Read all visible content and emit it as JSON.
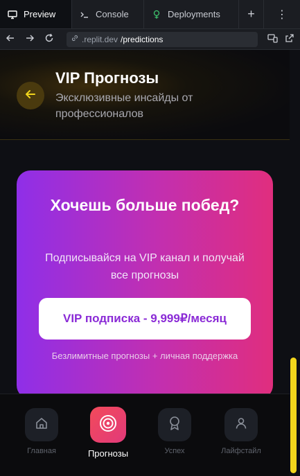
{
  "replit": {
    "tabs": [
      {
        "label": "Preview",
        "icon": "monitor-icon",
        "active": true
      },
      {
        "label": "Console",
        "icon": "terminal-icon"
      },
      {
        "label": "Deployments",
        "icon": "deploy-icon"
      }
    ],
    "add_tab": "+",
    "more": "⋮",
    "url": {
      "domain": ".replit.dev",
      "path": "/predictions"
    }
  },
  "header": {
    "title": "VIP Прогнозы",
    "subtitle": "Эксклюзивные инсайды от профессионалов"
  },
  "vip_card": {
    "title": "Хочешь больше побед?",
    "text": "Подписывайся на VIP канал и получай все прогнозы",
    "button": "VIP подписка - 9,999₽/месяц",
    "note": "Безлимитные прогнозы + личная поддержка"
  },
  "bottom_nav": [
    {
      "label": "Главная",
      "icon": "home-icon",
      "active": false
    },
    {
      "label": "Прогнозы",
      "icon": "target-icon",
      "active": true
    },
    {
      "label": "Успех",
      "icon": "award-icon",
      "active": false
    },
    {
      "label": "Лайфстайл",
      "icon": "user-icon",
      "active": false
    }
  ],
  "colors": {
    "accent_yellow": "#f2d61c",
    "card_gradient_start": "#8f2fe8",
    "card_gradient_end": "#e02e7e",
    "active_nav": "#f24a5a"
  }
}
